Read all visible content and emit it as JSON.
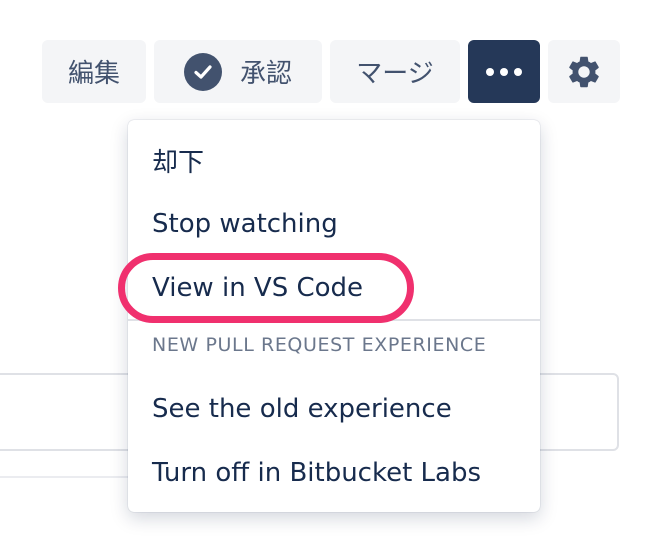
{
  "toolbar": {
    "edit_label": "編集",
    "approve_label": "承認",
    "merge_label": "マージ",
    "more_icon": "more-horizontal-icon",
    "settings_icon": "gear-icon",
    "approve_icon": "check-circle-icon"
  },
  "menu": {
    "items": [
      {
        "label": "却下"
      },
      {
        "label": "Stop watching"
      },
      {
        "label": "View in VS Code"
      }
    ],
    "group_heading": "NEW PULL REQUEST EXPERIENCE",
    "group_items": [
      {
        "label": "See the old experience"
      },
      {
        "label": "Turn off in Bitbucket Labs"
      }
    ]
  },
  "colors": {
    "highlight": "#f0306e",
    "active_button": "#253858",
    "button_bg": "#f4f5f7",
    "text": "#172b4d",
    "muted": "#6b778c"
  }
}
